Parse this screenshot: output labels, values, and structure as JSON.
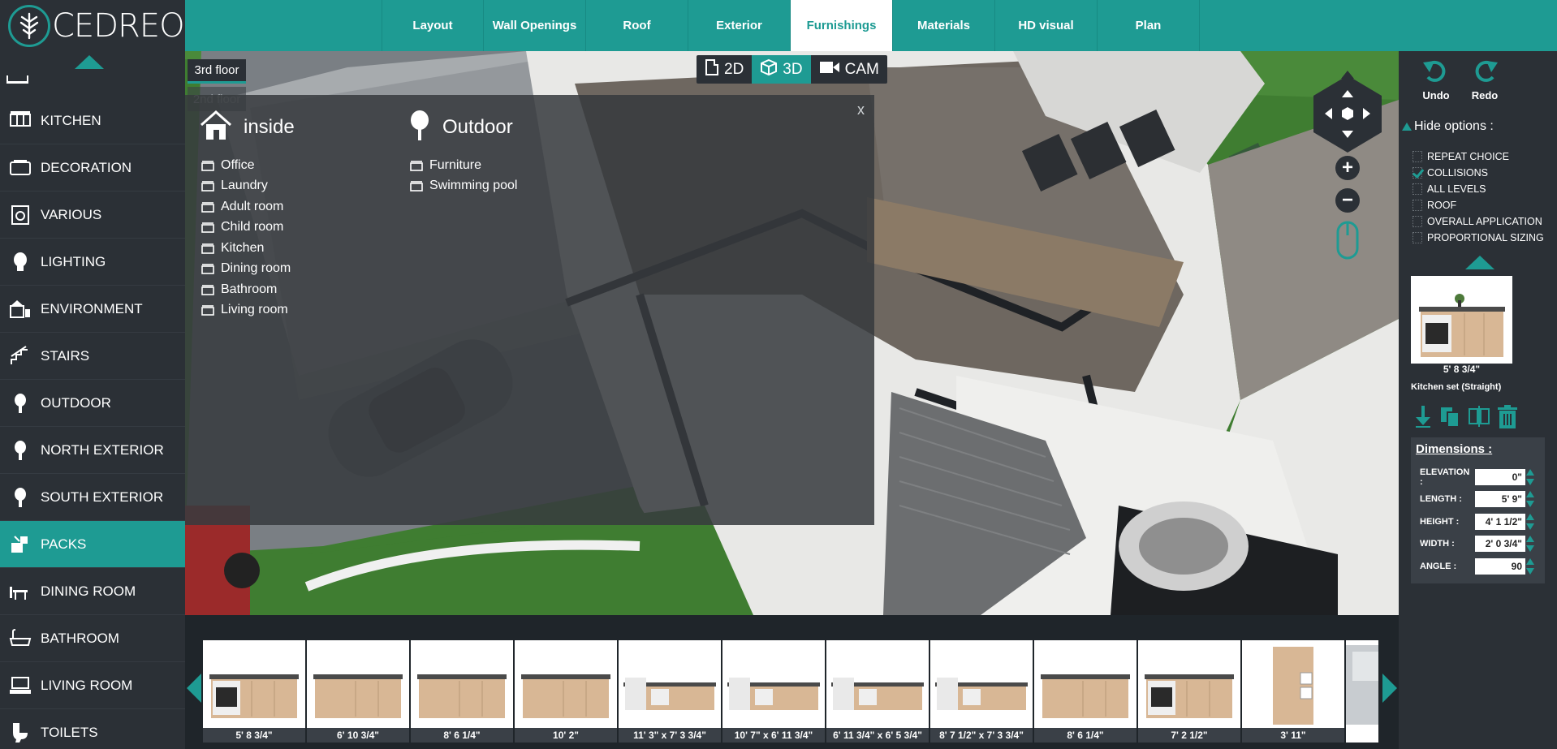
{
  "brand": {
    "name": "CEDREO"
  },
  "tabs": [
    {
      "label": "Layout",
      "active": false
    },
    {
      "label": "Wall Openings",
      "active": false
    },
    {
      "label": "Roof",
      "active": false
    },
    {
      "label": "Exterior",
      "active": false
    },
    {
      "label": "Furnishings",
      "active": true
    },
    {
      "label": "Materials",
      "active": false
    },
    {
      "label": "HD visual",
      "active": false
    },
    {
      "label": "Plan",
      "active": false
    }
  ],
  "sidebar": {
    "items": [
      {
        "label": "KITCHEN",
        "icon": "kitchen-icon"
      },
      {
        "label": "DECORATION",
        "icon": "decoration-icon"
      },
      {
        "label": "VARIOUS",
        "icon": "various-icon"
      },
      {
        "label": "LIGHTING",
        "icon": "lighting-icon"
      },
      {
        "label": "ENVIRONMENT",
        "icon": "environment-icon"
      },
      {
        "label": "STAIRS",
        "icon": "stairs-icon"
      },
      {
        "label": "OUTDOOR",
        "icon": "tree-icon"
      },
      {
        "label": "NORTH EXTERIOR",
        "icon": "tree-icon"
      },
      {
        "label": "SOUTH EXTERIOR",
        "icon": "tree-icon"
      },
      {
        "label": "PACKS",
        "icon": "packs-icon",
        "active": true
      },
      {
        "label": "DINING ROOM",
        "icon": "dining-icon"
      },
      {
        "label": "BATHROOM",
        "icon": "bathtub-icon"
      },
      {
        "label": "LIVING ROOM",
        "icon": "tv-icon"
      },
      {
        "label": "TOILETS",
        "icon": "toilet-icon"
      }
    ]
  },
  "floors": {
    "current": "3rd floor",
    "other": "2nd floor"
  },
  "viewmodes": [
    {
      "label": "2D",
      "active": false
    },
    {
      "label": "3D",
      "active": true
    },
    {
      "label": "CAM",
      "active": false
    }
  ],
  "overlay": {
    "close": "x",
    "inside": {
      "title": "inside",
      "items": [
        "Office",
        "Laundry",
        "Adult room",
        "Child room",
        "Kitchen",
        "Dining room",
        "Bathroom",
        "Living room"
      ]
    },
    "outdoor": {
      "title": "Outdoor",
      "items": [
        "Furniture",
        "Swimming pool"
      ]
    }
  },
  "rightpanel": {
    "undo": "Undo",
    "redo": "Redo",
    "hide_options": "Hide options :",
    "options": [
      {
        "label": "REPEAT CHOICE",
        "checked": false
      },
      {
        "label": "COLLISIONS",
        "checked": true
      },
      {
        "label": "ALL LEVELS",
        "checked": false
      },
      {
        "label": "ROOF",
        "checked": false
      },
      {
        "label": "OVERALL APPLICATION",
        "checked": false
      },
      {
        "label": "PROPORTIONAL SIZING",
        "checked": false
      }
    ],
    "selected": {
      "dimension": "5' 8 3/4\"",
      "name": "Kitchen set (Straight)"
    },
    "dimensions": {
      "title": "Dimensions :",
      "rows": [
        {
          "label": "ELEVATION :",
          "value": "0\""
        },
        {
          "label": "LENGTH :",
          "value": "5' 9\""
        },
        {
          "label": "HEIGHT :",
          "value": "4' 1 1/2\""
        },
        {
          "label": "WIDTH :",
          "value": "2' 0 3/4\""
        },
        {
          "label": "ANGLE :",
          "value": "90"
        }
      ]
    }
  },
  "catalog": [
    {
      "size": "5' 8 3/4\"",
      "kind": "straight-oven"
    },
    {
      "size": "6' 10 3/4\"",
      "kind": "straight"
    },
    {
      "size": "8' 6 1/4\"",
      "kind": "straight"
    },
    {
      "size": "10' 2\"",
      "kind": "straight"
    },
    {
      "size": "11' 3\" x 7' 3 3/4\"",
      "kind": "corner"
    },
    {
      "size": "10' 7\" x 6' 11 3/4\"",
      "kind": "corner"
    },
    {
      "size": "6' 11 3/4\" x 6' 5 3/4\"",
      "kind": "corner"
    },
    {
      "size": "8' 7 1/2\" x 7' 3 3/4\"",
      "kind": "corner"
    },
    {
      "size": "8' 6 1/4\"",
      "kind": "straight"
    },
    {
      "size": "7' 2 1/2\"",
      "kind": "straight-oven"
    },
    {
      "size": "3' 11\"",
      "kind": "tall"
    },
    {
      "size": "",
      "kind": "partial"
    }
  ],
  "colors": {
    "accent": "#1e9b93",
    "panel": "#2b3036",
    "strip": "#1f252a"
  }
}
